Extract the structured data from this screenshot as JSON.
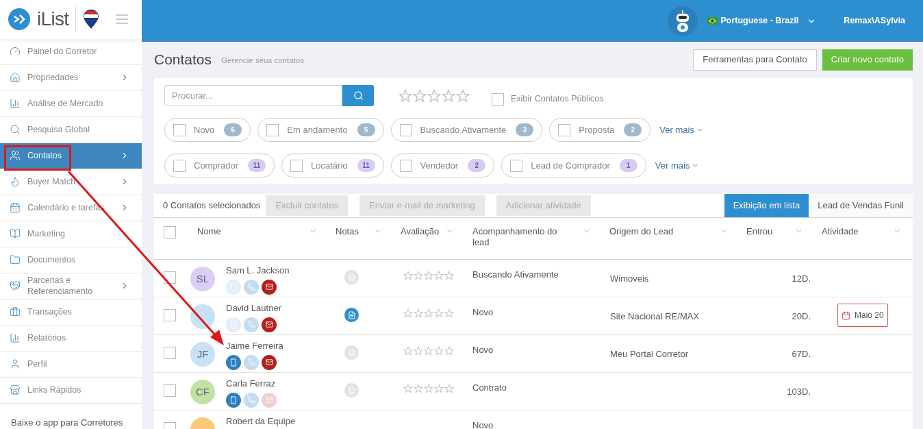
{
  "brand": {
    "name": "iList"
  },
  "header": {
    "language": "Portuguese - Brazil",
    "user": "Remax\\ASylvia"
  },
  "sidebar": {
    "items": [
      {
        "label": "Painel do Corretor",
        "selected": false,
        "has_submenu": false
      },
      {
        "label": "Propriedades",
        "selected": false,
        "has_submenu": true
      },
      {
        "label": "Análise de Mercado",
        "selected": false,
        "has_submenu": false
      },
      {
        "label": "Pesquisa Global",
        "selected": false,
        "has_submenu": false
      },
      {
        "label": "Contatos",
        "selected": true,
        "has_submenu": true
      },
      {
        "label": "Buyer Match",
        "selected": false,
        "has_submenu": true
      },
      {
        "label": "Calendário e tarefas",
        "selected": false,
        "has_submenu": true
      },
      {
        "label": "Marketing",
        "selected": false,
        "has_submenu": false
      },
      {
        "label": "Documentos",
        "selected": false,
        "has_submenu": false
      },
      {
        "label": "Parcerias e Referenciamento",
        "selected": false,
        "has_submenu": true
      },
      {
        "label": "Transações",
        "selected": false,
        "has_submenu": false
      },
      {
        "label": "Relatórios",
        "selected": false,
        "has_submenu": false
      },
      {
        "label": "Perfil",
        "selected": false,
        "has_submenu": false
      },
      {
        "label": "Links Rápidos",
        "selected": false,
        "has_submenu": false
      }
    ],
    "footer": "Baixe o app para Corretores"
  },
  "page": {
    "title": "Contatos",
    "subtitle": "Gerencie seus contatos",
    "buttons": [
      {
        "label": "Ferramentas para Contato",
        "kind": "outline"
      },
      {
        "label": "Criar novo contato",
        "kind": "primary"
      }
    ]
  },
  "filters": {
    "search_placeholder": "Procurar...",
    "stars": 0,
    "public_label": "Exibir Contatos Públicos",
    "public_checked": false,
    "groups": [
      {
        "chips": [
          {
            "label": "Novo",
            "count": "6",
            "checked": false,
            "color": "#9fb8cc"
          },
          {
            "label": "Em andamento",
            "count": "5",
            "checked": false,
            "color": "#9fb8cc"
          },
          {
            "label": "Buscando Ativamente",
            "count": "3",
            "checked": false,
            "color": "#9fb8cc"
          },
          {
            "label": "Proposta",
            "count": "2",
            "checked": false,
            "color": "#9fb8cc"
          }
        ],
        "more": "Ver mais"
      },
      {
        "chips": [
          {
            "label": "Comprador",
            "count": "11",
            "checked": false,
            "color": "#d9ccf2"
          },
          {
            "label": "Locatário",
            "count": "11",
            "checked": false,
            "color": "#d9ccf2"
          },
          {
            "label": "Vendedor",
            "count": "2",
            "checked": false,
            "color": "#d9ccf2"
          },
          {
            "label": "Lead de Comprador",
            "count": "1",
            "checked": false,
            "color": "#d9ccf2"
          }
        ],
        "more": "Ver mais"
      }
    ]
  },
  "toolbar": {
    "selected_count": "0 Contatos selecionados",
    "actions": [
      "Excluir contatos",
      "Enviar e-mail de marketing",
      "Adicionar atividade"
    ],
    "views": [
      {
        "label": "Exibição em lista",
        "selected": true
      },
      {
        "label": "Lead de Vendas Funil",
        "selected": false
      }
    ]
  },
  "table": {
    "select_all_checked": false,
    "columns": [
      "Nome",
      "Notas",
      "Avaliação",
      "Acompanhamento do lead",
      "Origem do Lead",
      "Entrou",
      "Atividade"
    ],
    "rows": [
      {
        "initials": "SL",
        "color": "#dccdf3",
        "name": "Sam L. Jackson",
        "mobile": false,
        "email": true,
        "has_notes": false,
        "stars": 0,
        "stage": "Buscando Ativamente",
        "source": "Wimoveis",
        "entered": "12D.",
        "checked": false
      },
      {
        "color": "#c7e1f5",
        "name": "David Lautner",
        "mobile": false,
        "email": true,
        "has_notes": true,
        "stars": 0,
        "stage": "Novo",
        "source": "Site Nacional RE/MAX",
        "entered": "20D.",
        "activity": "Maio 20",
        "checked": false
      },
      {
        "initials": "JF",
        "color": "#c7e1f5",
        "name": "Jaime Ferreira",
        "mobile": true,
        "email": true,
        "has_notes": false,
        "stars": 0,
        "stage": "Novo",
        "source": "Meu Portal Corretor",
        "entered": "67D.",
        "checked": false
      },
      {
        "initials": "CF",
        "color": "#c4e1a4",
        "name": "Carla Ferraz",
        "mobile": true,
        "email": false,
        "has_notes": false,
        "stars": 0,
        "stage": "Contrato",
        "entered": "103D.",
        "checked": false
      },
      {
        "color": "#fcc97a",
        "name": "Robert da Equipe",
        "stage": "Novo",
        "checked": false
      }
    ]
  }
}
